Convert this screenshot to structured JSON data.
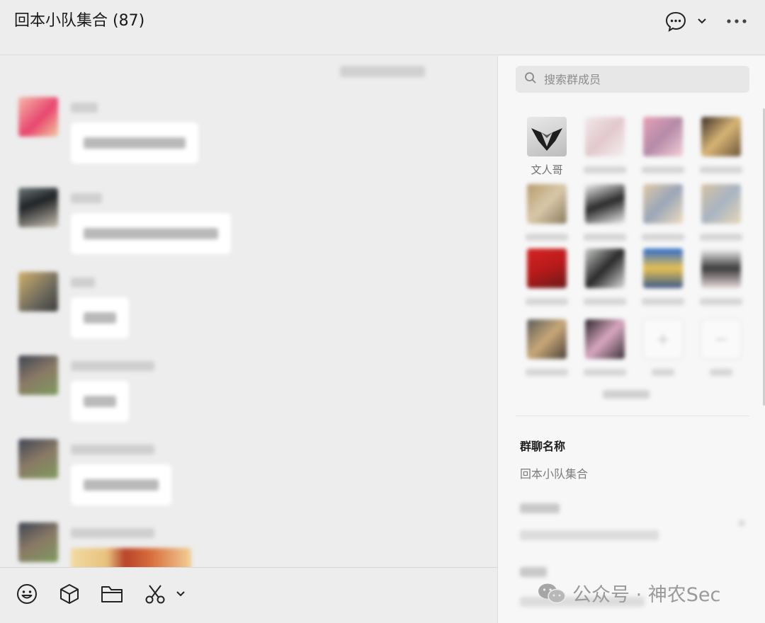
{
  "header": {
    "title": "回本小队集合 (87)",
    "icons": [
      "chat-bubble-icon",
      "chevron-down-icon",
      "more-icon"
    ]
  },
  "toolbar": {
    "icons": [
      "emoji-icon",
      "cube-icon",
      "folder-icon",
      "scissors-icon",
      "chevron-down-icon"
    ]
  },
  "panel": {
    "search": {
      "placeholder": "搜索群成员"
    },
    "members": [
      {
        "name": "文人哥"
      }
    ],
    "group_name_label": "群聊名称",
    "group_name_value": "回本小队集合"
  },
  "watermark": {
    "text": "公众号 · 神农Sec"
  },
  "colors": {
    "background": "#ededed",
    "panel": "#f7f7f7",
    "bubble": "#ffffff"
  }
}
